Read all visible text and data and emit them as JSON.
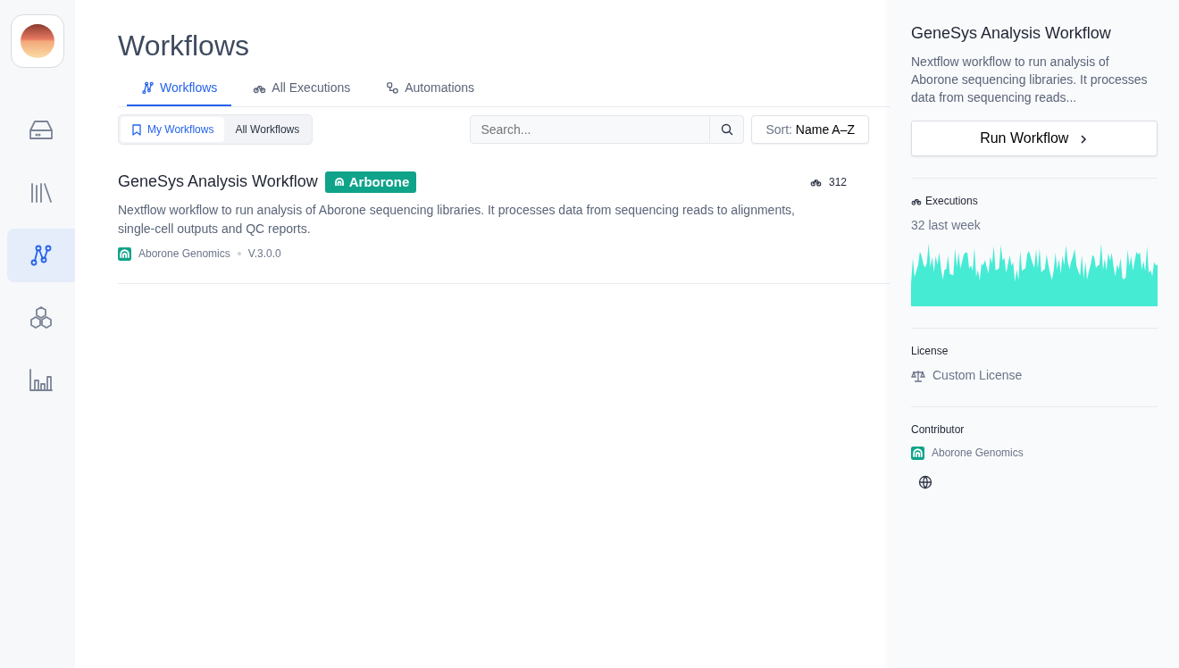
{
  "sidebar": {
    "items": [
      {
        "kind": "storage",
        "selected": false
      },
      {
        "kind": "library",
        "selected": false
      },
      {
        "kind": "workflows",
        "selected": true
      },
      {
        "kind": "modules",
        "selected": false
      },
      {
        "kind": "analytics",
        "selected": false
      }
    ]
  },
  "page": {
    "title": "Workflows"
  },
  "tabs": [
    {
      "kind": "workflows",
      "label": "Workflows",
      "selected": true
    },
    {
      "kind": "executions",
      "label": "All Executions",
      "selected": false
    },
    {
      "kind": "automations",
      "label": "Automations",
      "selected": false
    }
  ],
  "filter": {
    "options": [
      {
        "label": "My Workflows",
        "selected": true
      },
      {
        "label": "All Workflows",
        "selected": false
      }
    ]
  },
  "search": {
    "placeholder": "Search..."
  },
  "sort": {
    "label": "Sort:",
    "value": "Name A–Z"
  },
  "workflows": [
    {
      "title": "GeneSys Analysis Workflow",
      "badge": "Arborone",
      "executions": "312",
      "description": "Nextflow workflow to run analysis of Aborone sequencing libraries. It processes data from sequencing reads to alignments, single-cell outputs and QC reports.",
      "owner": "Aborone Genomics",
      "version": "V.3.0.0"
    }
  ],
  "details": {
    "title": "GeneSys Analysis Workflow",
    "description": "Nextflow workflow to run analysis of Aborone sequencing libraries. It processes data from sequencing reads...",
    "run_button": "Run Workflow",
    "executions_label": "Executions",
    "executions_summary": "32 last week",
    "license_label": "License",
    "license": "Custom License",
    "contributor_label": "Contributor",
    "contributor": "Aborone Genomics"
  }
}
